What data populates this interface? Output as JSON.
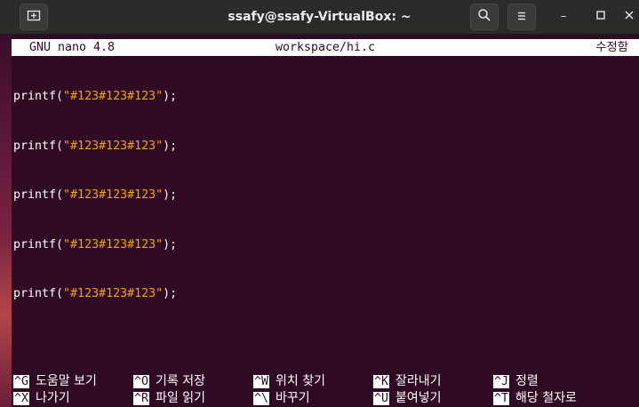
{
  "titlebar": {
    "title": "ssafy@ssafy-VirtualBox: ~",
    "new_tab_icon": "new-tab-icon",
    "search_icon": "search-icon",
    "menu_icon": "hamburger-menu-icon",
    "minimize_glyph": "–",
    "maximize_glyph": "□",
    "close_glyph": "✕"
  },
  "nano": {
    "version": "GNU nano 4.8",
    "filename": "workspace/hi.c",
    "status": "수정함",
    "lines": [
      {
        "pre": "printf(",
        "str": "\"#123#123#123\"",
        "post": ");"
      },
      {
        "pre": "printf(",
        "str": "\"#123#123#123\"",
        "post": ");"
      },
      {
        "pre": "printf(",
        "str": "\"#123#123#123\"",
        "post": ");"
      },
      {
        "pre": "printf(",
        "str": "\"#123#123#123\"",
        "post": ");"
      },
      {
        "pre": "printf(",
        "str": "\"#123#123#123\"",
        "post": ");"
      }
    ],
    "shortcuts_row1": [
      {
        "key": "^G",
        "label": "도움말 보기"
      },
      {
        "key": "^O",
        "label": "기록 저장"
      },
      {
        "key": "^W",
        "label": "위치 찾기"
      },
      {
        "key": "^K",
        "label": "잘라내기"
      },
      {
        "key": "^J",
        "label": "정렬"
      }
    ],
    "shortcuts_row2": [
      {
        "key": "^X",
        "label": "나가기"
      },
      {
        "key": "^R",
        "label": "파일 읽기"
      },
      {
        "key": "^\\",
        "label": "바꾸기"
      },
      {
        "key": "^U",
        "label": "붙여넣기"
      },
      {
        "key": "^T",
        "label": "해당 철자로"
      }
    ]
  },
  "colors": {
    "terminal_bg": "#300a24",
    "string_literal": "#f0a30a",
    "titlebar_bg": "#2b2b2b"
  }
}
